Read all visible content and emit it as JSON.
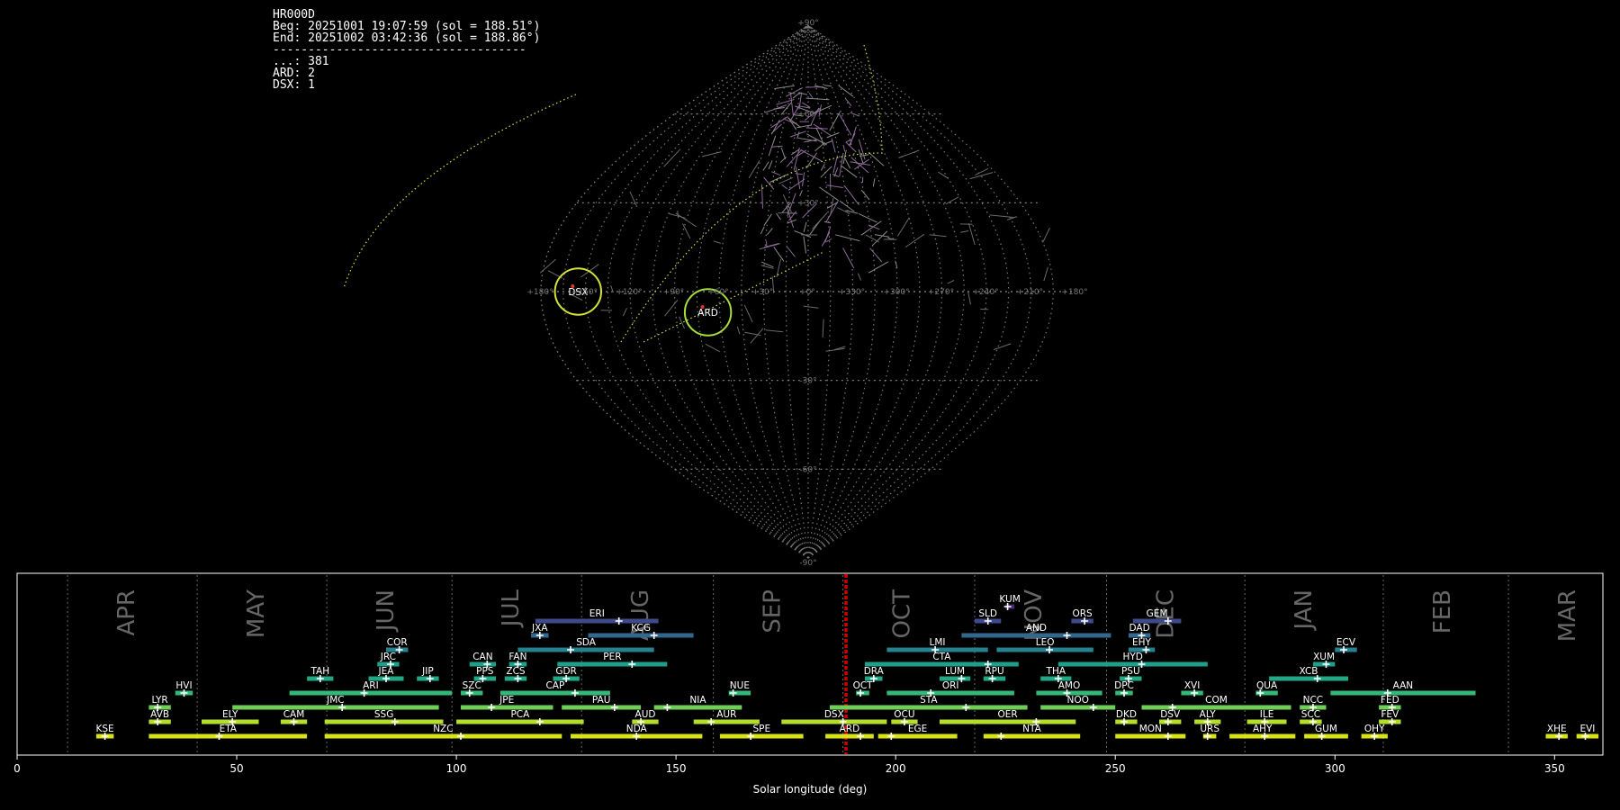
{
  "stats": {
    "station": "HR000D",
    "begin": "Beg: 20251001 19:07:59 (sol = 188.51°)",
    "end": "End: 20251002 03:42:36 (sol = 188.86°)",
    "separator": "------------------------------------",
    "counts": [
      "...: 381",
      "ARD: 2",
      "DSX: 1"
    ]
  },
  "chart_data": [
    {
      "type": "scatter",
      "projection": "sinusoidal",
      "grid": true,
      "lon_tick_labels": [
        "+180°",
        "+150°",
        "+120°",
        "+90°",
        "+60°",
        "+30°",
        "+0°",
        "+330°",
        "+300°",
        "+270°",
        "+240°",
        "+210°",
        "+180°"
      ],
      "lat_tick_labels": [
        "+90°",
        "+60°",
        "+30°",
        "-30°",
        "-60°",
        "-90°"
      ],
      "radiants": [
        {
          "name": "DSX",
          "lon": 155,
          "lat": 0,
          "color": "#d4e337",
          "radius": 6
        },
        {
          "name": "ARD",
          "lon": 68,
          "lat": -7,
          "color": "#a8dc3c",
          "radius": 6
        }
      ],
      "colors": {
        "sporadic": "#8a8a8a",
        "high": "#8c6a99",
        "circle": "#d4e337"
      }
    },
    {
      "type": "gantt",
      "xlabel": "Solar longitude (deg)",
      "xlim": [
        0,
        361
      ],
      "x_ticks": [
        0,
        50,
        100,
        150,
        200,
        250,
        300,
        350
      ],
      "current_sol": 188.7,
      "months": [
        {
          "name": "APR",
          "sol": 11.5
        },
        {
          "name": "MAY",
          "sol": 41
        },
        {
          "name": "JUN",
          "sol": 70.5
        },
        {
          "name": "JUL",
          "sol": 99
        },
        {
          "name": "AUG",
          "sol": 128.5
        },
        {
          "name": "SEP",
          "sol": 158.5
        },
        {
          "name": "OCT",
          "sol": 188
        },
        {
          "name": "NOV",
          "sol": 218
        },
        {
          "name": "DEC",
          "sol": 248
        },
        {
          "name": "JAN",
          "sol": 279.5
        },
        {
          "name": "FEB",
          "sol": 311
        },
        {
          "name": "MAR",
          "sol": 339.5
        }
      ],
      "showers": [
        {
          "code": "KUM",
          "start": 225,
          "end": 227,
          "peak": 225.5,
          "level": 11,
          "color": "#482878"
        },
        {
          "code": "ERI",
          "start": 118,
          "end": 146,
          "peak": 137,
          "level": 10,
          "color": "#3e4a89"
        },
        {
          "code": "SLD",
          "start": 218,
          "end": 224,
          "peak": 221,
          "level": 10,
          "color": "#3e4a89"
        },
        {
          "code": "ORS",
          "start": 240,
          "end": 245,
          "peak": 243,
          "level": 10,
          "color": "#3e4a89"
        },
        {
          "code": "GEM",
          "start": 254,
          "end": 265,
          "peak": 262,
          "level": 10,
          "color": "#3e4a89"
        },
        {
          "code": "JXA",
          "start": 117,
          "end": 121,
          "peak": 119,
          "level": 9,
          "color": "#31688e"
        },
        {
          "code": "KCG",
          "start": 130,
          "end": 154,
          "peak": 145,
          "level": 9,
          "color": "#31688e"
        },
        {
          "code": "AND",
          "start": 215,
          "end": 249,
          "peak": 239,
          "level": 9,
          "color": "#31688e"
        },
        {
          "code": "DAD",
          "start": 253,
          "end": 258,
          "peak": 256,
          "level": 9,
          "color": "#31688e"
        },
        {
          "code": "COR",
          "start": 84,
          "end": 89,
          "peak": 87,
          "level": 8,
          "color": "#26828e"
        },
        {
          "code": "SDA",
          "start": 114,
          "end": 145,
          "peak": 126,
          "level": 8,
          "color": "#26828e"
        },
        {
          "code": "LMI",
          "start": 198,
          "end": 221,
          "peak": 209,
          "level": 8,
          "color": "#26828e"
        },
        {
          "code": "LEO",
          "start": 223,
          "end": 245,
          "peak": 235,
          "level": 8,
          "color": "#26828e"
        },
        {
          "code": "EHY",
          "start": 253,
          "end": 259,
          "peak": 257,
          "level": 8,
          "color": "#26828e"
        },
        {
          "code": "ECV",
          "start": 300,
          "end": 305,
          "peak": 302,
          "level": 8,
          "color": "#26828e"
        },
        {
          "code": "JRC",
          "start": 82,
          "end": 87,
          "peak": 85,
          "level": 7,
          "color": "#1f9e89"
        },
        {
          "code": "CAN",
          "start": 103,
          "end": 109,
          "peak": 107,
          "level": 7,
          "color": "#1f9e89"
        },
        {
          "code": "FAN",
          "start": 112,
          "end": 116,
          "peak": 114,
          "level": 7,
          "color": "#1f9e89"
        },
        {
          "code": "PER",
          "start": 123,
          "end": 148,
          "peak": 140,
          "level": 7,
          "color": "#1f9e89"
        },
        {
          "code": "CTA",
          "start": 193,
          "end": 228,
          "peak": 221,
          "level": 7,
          "color": "#1f9e89"
        },
        {
          "code": "HYD",
          "start": 237,
          "end": 271,
          "peak": 256,
          "level": 7,
          "color": "#1f9e89"
        },
        {
          "code": "XUM",
          "start": 295,
          "end": 300,
          "peak": 298,
          "level": 7,
          "color": "#1f9e89"
        },
        {
          "code": "TAH",
          "start": 66,
          "end": 72,
          "peak": 69,
          "level": 6,
          "color": "#22a884"
        },
        {
          "code": "JEA",
          "start": 80,
          "end": 88,
          "peak": 84,
          "level": 6,
          "color": "#22a884"
        },
        {
          "code": "JIP",
          "start": 91,
          "end": 96,
          "peak": 94,
          "level": 6,
          "color": "#22a884"
        },
        {
          "code": "PPS",
          "start": 104,
          "end": 109,
          "peak": 106,
          "level": 6,
          "color": "#22a884"
        },
        {
          "code": "ZCS",
          "start": 111,
          "end": 116,
          "peak": 114,
          "level": 6,
          "color": "#22a884"
        },
        {
          "code": "GDR",
          "start": 122,
          "end": 128,
          "peak": 125,
          "level": 6,
          "color": "#22a884"
        },
        {
          "code": "DRA",
          "start": 193,
          "end": 197,
          "peak": 195,
          "level": 6,
          "color": "#22a884"
        },
        {
          "code": "LUM",
          "start": 210,
          "end": 217,
          "peak": 215,
          "level": 6,
          "color": "#22a884"
        },
        {
          "code": "RPU",
          "start": 220,
          "end": 225,
          "peak": 222,
          "level": 6,
          "color": "#22a884"
        },
        {
          "code": "THA",
          "start": 233,
          "end": 240,
          "peak": 237,
          "level": 6,
          "color": "#22a884"
        },
        {
          "code": "PSU",
          "start": 251,
          "end": 256,
          "peak": 253,
          "level": 6,
          "color": "#22a884"
        },
        {
          "code": "XCB",
          "start": 285,
          "end": 303,
          "peak": 296,
          "level": 6,
          "color": "#22a884"
        },
        {
          "code": "HVI",
          "start": 36,
          "end": 40,
          "peak": 38,
          "level": 5,
          "color": "#35b779"
        },
        {
          "code": "ARI",
          "start": 62,
          "end": 99,
          "peak": 79,
          "level": 5,
          "color": "#35b779"
        },
        {
          "code": "SZC",
          "start": 101,
          "end": 106,
          "peak": 103,
          "level": 5,
          "color": "#35b779"
        },
        {
          "code": "CAP",
          "start": 110,
          "end": 135,
          "peak": 127,
          "level": 5,
          "color": "#35b779"
        },
        {
          "code": "NUE",
          "start": 162,
          "end": 167,
          "peak": 163,
          "level": 5,
          "color": "#35b779"
        },
        {
          "code": "OCT",
          "start": 191,
          "end": 194,
          "peak": 192,
          "level": 5,
          "color": "#35b779"
        },
        {
          "code": "ORI",
          "start": 198,
          "end": 227,
          "peak": 208,
          "level": 5,
          "color": "#35b779"
        },
        {
          "code": "AMO",
          "start": 232,
          "end": 247,
          "peak": 239,
          "level": 5,
          "color": "#35b779"
        },
        {
          "code": "DPC",
          "start": 250,
          "end": 254,
          "peak": 252,
          "level": 5,
          "color": "#35b779"
        },
        {
          "code": "XVI",
          "start": 265,
          "end": 270,
          "peak": 268,
          "level": 5,
          "color": "#35b779"
        },
        {
          "code": "QUA",
          "start": 282,
          "end": 287,
          "peak": 283,
          "level": 5,
          "color": "#35b779"
        },
        {
          "code": "AAN",
          "start": 299,
          "end": 332,
          "peak": 312,
          "level": 5,
          "color": "#35b779"
        },
        {
          "code": "LYR",
          "start": 30,
          "end": 35,
          "peak": 32,
          "level": 4,
          "color": "#6ece58"
        },
        {
          "code": "JMC",
          "start": 49,
          "end": 96,
          "peak": 74,
          "level": 4,
          "color": "#6ece58"
        },
        {
          "code": "JPE",
          "start": 101,
          "end": 122,
          "peak": 108,
          "level": 4,
          "color": "#6ece58"
        },
        {
          "code": "PAU",
          "start": 124,
          "end": 142,
          "peak": 136,
          "level": 4,
          "color": "#6ece58"
        },
        {
          "code": "NIA",
          "start": 145,
          "end": 165,
          "peak": 148,
          "level": 4,
          "color": "#6ece58"
        },
        {
          "code": "STA",
          "start": 185,
          "end": 230,
          "peak": 216,
          "level": 4,
          "color": "#6ece58"
        },
        {
          "code": "NOO",
          "start": 233,
          "end": 250,
          "peak": 245,
          "level": 4,
          "color": "#6ece58"
        },
        {
          "code": "COM",
          "start": 256,
          "end": 290,
          "peak": 263,
          "level": 4,
          "color": "#6ece58"
        },
        {
          "code": "NCC",
          "start": 292,
          "end": 298,
          "peak": 295,
          "level": 4,
          "color": "#6ece58"
        },
        {
          "code": "FED",
          "start": 310,
          "end": 315,
          "peak": 313,
          "level": 4,
          "color": "#6ece58"
        },
        {
          "code": "AVB",
          "start": 30,
          "end": 35,
          "peak": 32,
          "level": 3,
          "color": "#b5de2b"
        },
        {
          "code": "ELY",
          "start": 42,
          "end": 55,
          "peak": 49,
          "level": 3,
          "color": "#b5de2b"
        },
        {
          "code": "CAM",
          "start": 60,
          "end": 66,
          "peak": 63,
          "level": 3,
          "color": "#b5de2b"
        },
        {
          "code": "SSG",
          "start": 70,
          "end": 97,
          "peak": 86,
          "level": 3,
          "color": "#b5de2b"
        },
        {
          "code": "PCA",
          "start": 100,
          "end": 129,
          "peak": 119,
          "level": 3,
          "color": "#b5de2b"
        },
        {
          "code": "AUD",
          "start": 140,
          "end": 146,
          "peak": 142,
          "level": 3,
          "color": "#b5de2b"
        },
        {
          "code": "AUR",
          "start": 154,
          "end": 169,
          "peak": 158,
          "level": 3,
          "color": "#b5de2b"
        },
        {
          "code": "DSX",
          "start": 174,
          "end": 198,
          "peak": 188,
          "level": 3,
          "color": "#b5de2b"
        },
        {
          "code": "OCU",
          "start": 199,
          "end": 205,
          "peak": 202,
          "level": 3,
          "color": "#b5de2b"
        },
        {
          "code": "OER",
          "start": 210,
          "end": 241,
          "peak": 232,
          "level": 3,
          "color": "#b5de2b"
        },
        {
          "code": "DKD",
          "start": 250,
          "end": 255,
          "peak": 252,
          "level": 3,
          "color": "#b5de2b"
        },
        {
          "code": "DSV",
          "start": 260,
          "end": 265,
          "peak": 262,
          "level": 3,
          "color": "#b5de2b"
        },
        {
          "code": "ALY",
          "start": 268,
          "end": 274,
          "peak": 271,
          "level": 3,
          "color": "#b5de2b"
        },
        {
          "code": "ILE",
          "start": 280,
          "end": 289,
          "peak": 284,
          "level": 3,
          "color": "#b5de2b"
        },
        {
          "code": "SCC",
          "start": 292,
          "end": 297,
          "peak": 295,
          "level": 3,
          "color": "#b5de2b"
        },
        {
          "code": "FEV",
          "start": 310,
          "end": 315,
          "peak": 313,
          "level": 3,
          "color": "#b5de2b"
        },
        {
          "code": "KSE",
          "start": 18,
          "end": 22,
          "peak": 20,
          "level": 2,
          "color": "#d8e219"
        },
        {
          "code": "ETA",
          "start": 30,
          "end": 66,
          "peak": 46,
          "level": 2,
          "color": "#d8e219"
        },
        {
          "code": "NZC",
          "start": 70,
          "end": 124,
          "peak": 101,
          "level": 2,
          "color": "#d8e219"
        },
        {
          "code": "NDA",
          "start": 126,
          "end": 156,
          "peak": 141,
          "level": 2,
          "color": "#d8e219"
        },
        {
          "code": "SPE",
          "start": 160,
          "end": 179,
          "peak": 167,
          "level": 2,
          "color": "#d8e219"
        },
        {
          "code": "ARD",
          "start": 184,
          "end": 195,
          "peak": 192,
          "level": 2,
          "color": "#d8e219"
        },
        {
          "code": "EGE",
          "start": 196,
          "end": 214,
          "peak": 199,
          "level": 2,
          "color": "#d8e219"
        },
        {
          "code": "NTA",
          "start": 220,
          "end": 242,
          "peak": 224,
          "level": 2,
          "color": "#d8e219"
        },
        {
          "code": "MON",
          "start": 250,
          "end": 266,
          "peak": 262,
          "level": 2,
          "color": "#d8e219"
        },
        {
          "code": "URS",
          "start": 270,
          "end": 273,
          "peak": 271,
          "level": 2,
          "color": "#d8e219"
        },
        {
          "code": "AHY",
          "start": 276,
          "end": 291,
          "peak": 284,
          "level": 2,
          "color": "#d8e219"
        },
        {
          "code": "GUM",
          "start": 293,
          "end": 303,
          "peak": 297,
          "level": 2,
          "color": "#d8e219"
        },
        {
          "code": "OHY",
          "start": 306,
          "end": 312,
          "peak": 309,
          "level": 2,
          "color": "#d8e219"
        },
        {
          "code": "XHE",
          "start": 348,
          "end": 353,
          "peak": 351,
          "level": 2,
          "color": "#d8e219"
        },
        {
          "code": "EVI",
          "start": 355,
          "end": 360,
          "peak": 357,
          "level": 2,
          "color": "#d8e219"
        }
      ]
    }
  ]
}
